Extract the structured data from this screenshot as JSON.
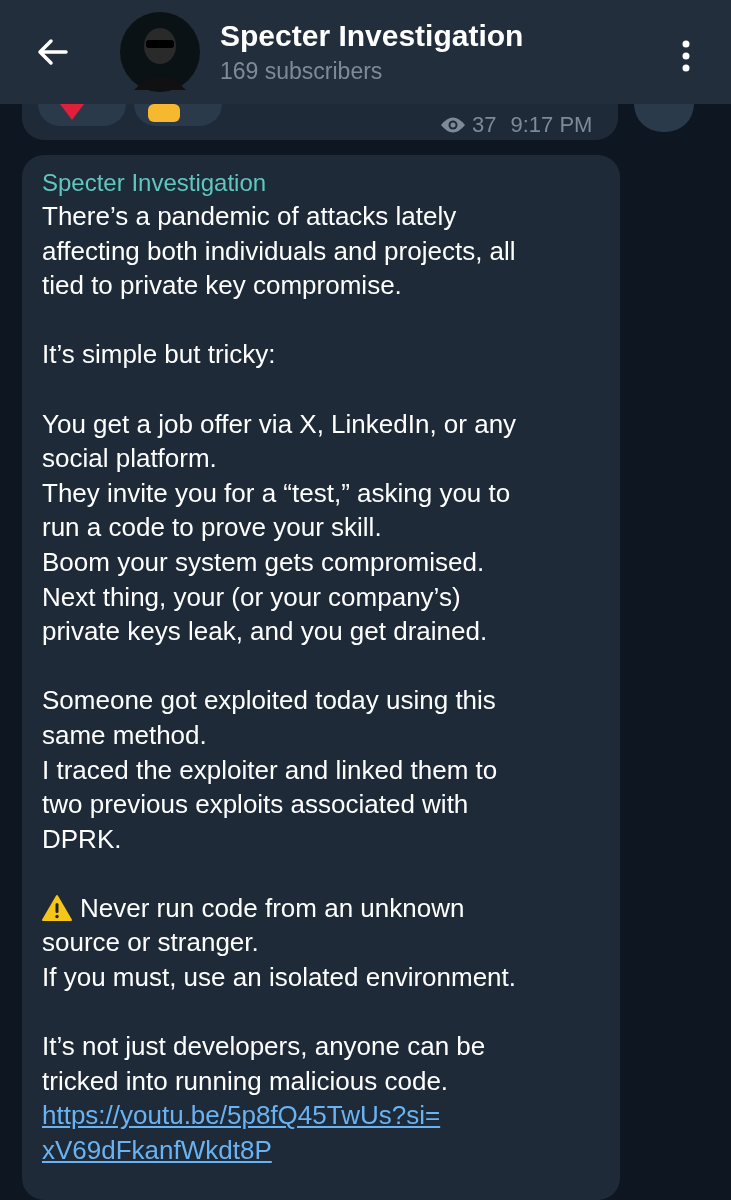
{
  "header": {
    "title": "Specter Investigation",
    "subtitle": "169 subscribers"
  },
  "previous_message": {
    "views": "37",
    "time": "9:17 PM"
  },
  "message": {
    "sender": "Specter Investigation",
    "paragraphs": [
      {
        "lines": [
          "There’s a pandemic of attacks lately",
          "affecting both individuals and projects, all",
          "tied to private key compromise."
        ]
      },
      {
        "lines": [
          "It’s simple but tricky:"
        ]
      },
      {
        "lines": [
          "You get a job offer via X, LinkedIn, or any",
          "social platform.",
          "They invite you for a “test,” asking you to",
          "run a code to prove your skill.",
          "Boom your system gets compromised.",
          "Next thing, your (or your company’s)",
          "private keys leak, and you get drained."
        ]
      },
      {
        "lines": [
          "Someone got exploited today using this",
          "same method.",
          "I traced the exploiter and linked them to",
          "two previous exploits associated with",
          "DPRK."
        ]
      },
      {
        "kind": "warning",
        "lines": [
          "Never run code from an unknown",
          "source or stranger.",
          "If you must, use an isolated environment."
        ]
      },
      {
        "lines": [
          "It’s not just developers, anyone can be",
          "tricked into running malicious code."
        ]
      }
    ],
    "link": {
      "lines": [
        "https://youtu.be/5p8fQ45TwUs?si=",
        "xV69dFkanfWkdt8P"
      ]
    }
  }
}
